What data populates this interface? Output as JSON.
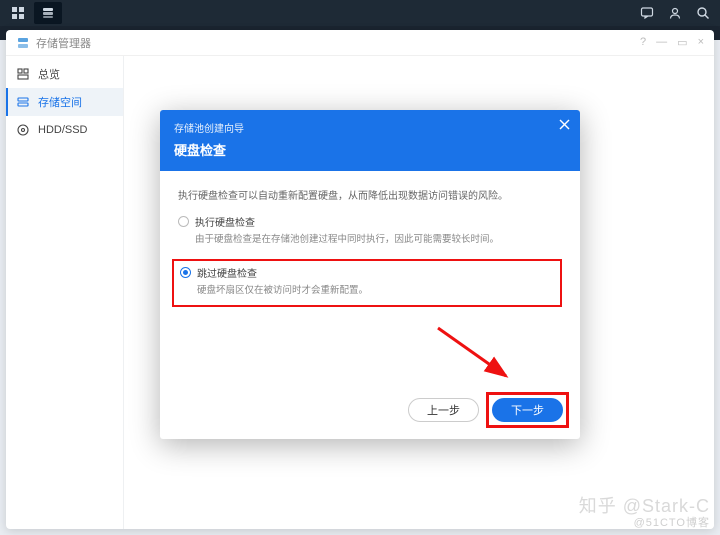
{
  "taskbar": {
    "left_apps": [
      "apps",
      "storage"
    ],
    "right_icons": [
      "chat",
      "user",
      "search"
    ]
  },
  "app": {
    "title": "存储管理器",
    "win_ctrls": {
      "help": "?",
      "min": "—",
      "max": "▭",
      "close": "×"
    }
  },
  "sidebar": {
    "items": [
      {
        "icon": "overview",
        "label": "总览"
      },
      {
        "icon": "storage",
        "label": "存储空间"
      },
      {
        "icon": "drive",
        "label": "HDD/SSD"
      }
    ],
    "active_index": 1
  },
  "dialog": {
    "sup": "存储池创建向导",
    "title": "硬盘检查",
    "intro": "执行硬盘检查可以自动重新配置硬盘，从而降低出现数据访问错误的风险。",
    "option1_label": "执行硬盘检查",
    "option1_desc": "由于硬盘检查是在存储池创建过程中同时执行，因此可能需要较长时间。",
    "option2_label": "跳过硬盘检查",
    "option2_desc": "硬盘坏扇区仅在被访问时才会重新配置。",
    "selected": 2,
    "back_label": "上一步",
    "next_label": "下一步"
  },
  "watermark": {
    "main": "知乎 @Stark-C",
    "sub": "@51CTO博客"
  }
}
